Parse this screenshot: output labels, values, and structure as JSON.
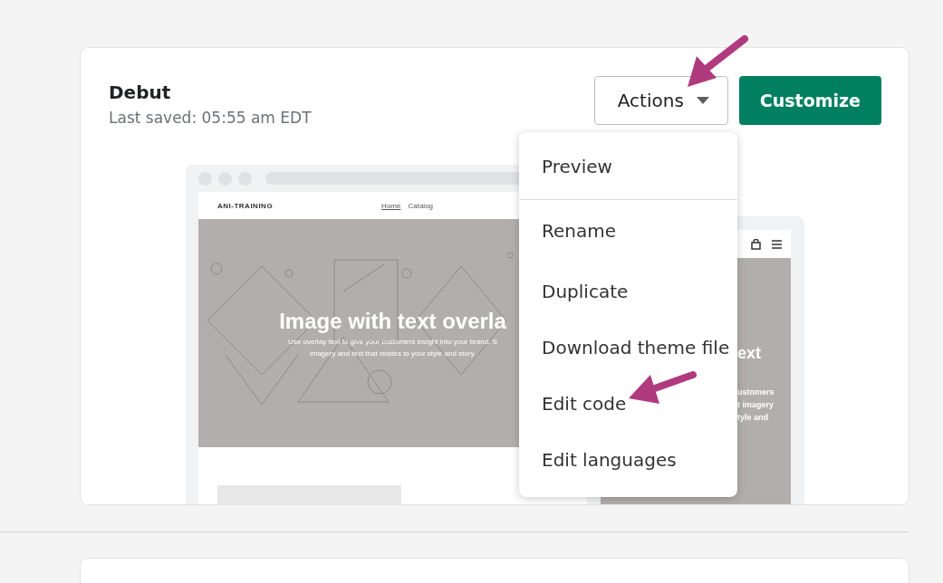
{
  "theme": {
    "name": "Debut",
    "last_saved": "Last saved: 05:55 am EDT"
  },
  "actions_button": {
    "label": "Actions",
    "expanded": true
  },
  "customize_button": {
    "label": "Customize"
  },
  "actions_menu": {
    "sections": [
      [
        {
          "label": "Preview"
        }
      ],
      [
        {
          "label": "Rename"
        },
        {
          "label": "Duplicate"
        },
        {
          "label": "Download theme file"
        },
        {
          "label": "Edit code"
        },
        {
          "label": "Edit languages"
        }
      ]
    ]
  },
  "desktop_preview": {
    "store_name": "ANI-TRAINING",
    "nav": [
      {
        "label": "Home",
        "selected": true
      },
      {
        "label": "Catalog",
        "selected": false
      }
    ],
    "hero_title": "Image with text overla",
    "hero_lines": [
      "Use overlay text to give your customers insight into your brand. S",
      "imagery and text that relates to your style and story."
    ]
  },
  "mobile_preview": {
    "hero_title": "ext",
    "hero_lines": [
      "ustomers",
      "t imagery",
      "tyle and"
    ]
  }
}
